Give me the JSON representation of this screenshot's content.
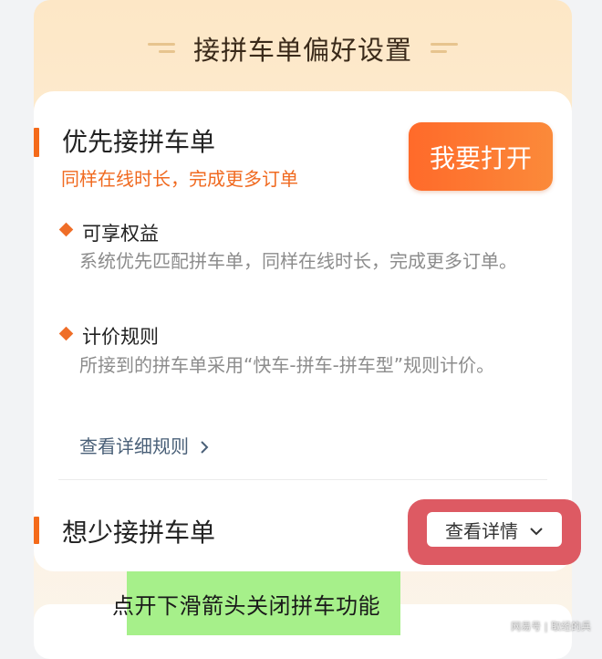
{
  "header": {
    "title": "接拼车单偏好设置"
  },
  "priority": {
    "title": "优先接拼车单",
    "subtitle": "同样在线时长，完成更多订单",
    "button_label": "我要打开",
    "benefit_title": "可享权益",
    "benefit_desc": "系统优先匹配拼车单，同样在线时长，完成更多订单。",
    "pricing_title": "计价规则",
    "pricing_desc": "所接到的拼车单采用“快车-拼车-拼车型”规则计价。",
    "rules_link": "查看详细规则"
  },
  "less": {
    "title": "想少接拼车单",
    "details_label": "查看详情"
  },
  "annotation": {
    "caption": "点开下滑箭头关闭拼车功能"
  },
  "watermark": {
    "text": "网易号 | 取经的兵"
  },
  "colors": {
    "accent": "#f46a1a",
    "highlight_red": "#dd5a63",
    "highlight_green": "#a6f08a"
  }
}
